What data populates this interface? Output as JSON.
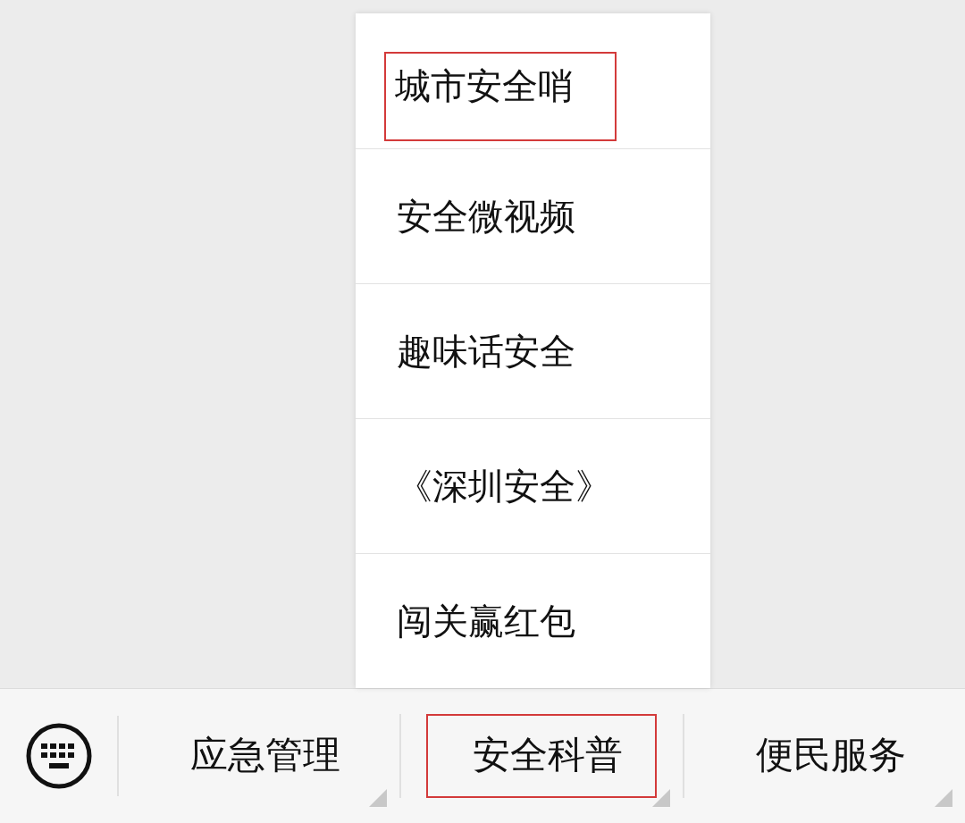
{
  "menu_items": [
    {
      "label": "城市安全哨",
      "highlighted": true
    },
    {
      "label": "安全微视频",
      "highlighted": false
    },
    {
      "label": "趣味话安全",
      "highlighted": false
    },
    {
      "label": "《深圳安全》",
      "highlighted": false
    },
    {
      "label": "闯关赢红包",
      "highlighted": false
    }
  ],
  "bottom_tabs": [
    {
      "label": "应急管理",
      "highlighted": false
    },
    {
      "label": "安全科普",
      "highlighted": true
    },
    {
      "label": "便民服务",
      "highlighted": false
    }
  ]
}
